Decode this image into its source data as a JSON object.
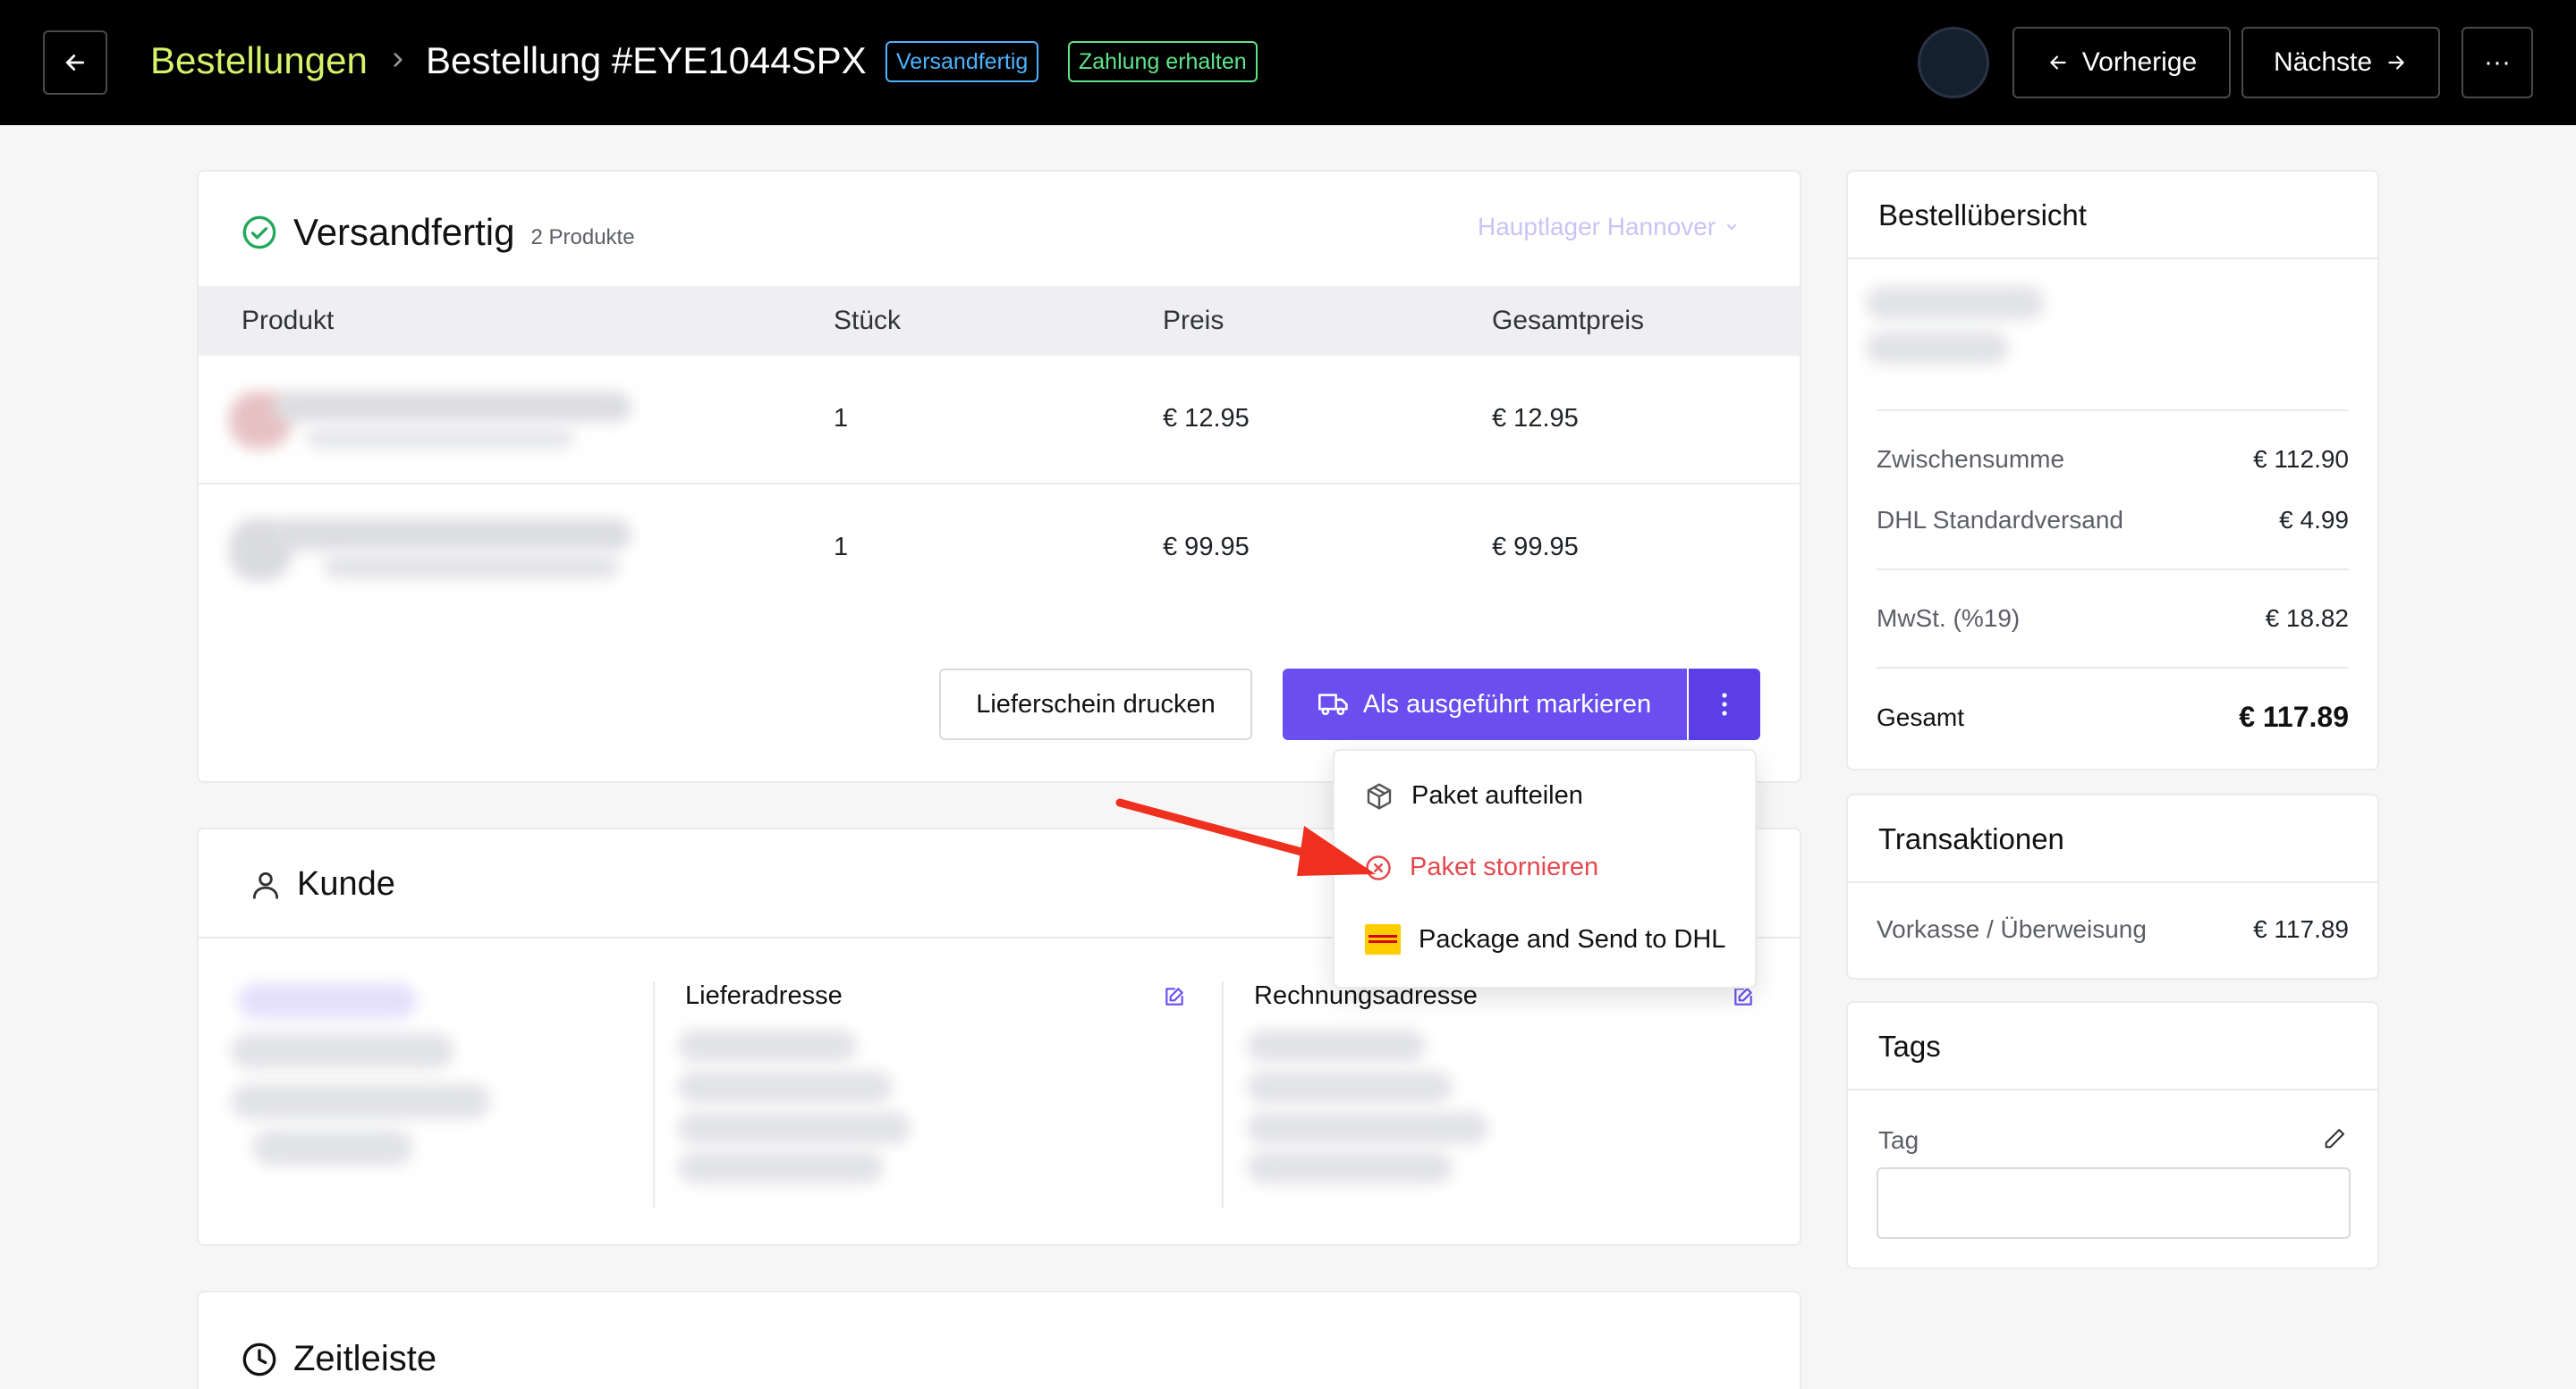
{
  "header": {
    "breadcrumb_root": "Bestellungen",
    "order_title": "Bestellung #EYE1044SPX",
    "badge_status": "Versandfertig",
    "badge_payment": "Zahlung erhalten",
    "prev_label": "Vorherige",
    "next_label": "Nächste",
    "more_label": "···"
  },
  "shipment": {
    "title": "Versandfertig",
    "count": "2 Produkte",
    "warehouse": "Hauptlager Hannover",
    "columns": [
      "Produkt",
      "Stück",
      "Preis",
      "Gesamtpreis"
    ],
    "rows": [
      {
        "qty": "1",
        "price": "€ 12.95",
        "total": "€ 12.95"
      },
      {
        "qty": "1",
        "price": "€ 99.95",
        "total": "€ 99.95"
      }
    ],
    "print_label": "Lieferschein drucken",
    "primary_label": "Als ausgeführt markieren"
  },
  "menu": {
    "items": [
      {
        "label": "Paket aufteilen"
      },
      {
        "label": "Paket stornieren"
      },
      {
        "label": "Package and Send to DHL"
      }
    ]
  },
  "customer": {
    "title": "Kunde",
    "shipping_label": "Lieferadresse",
    "billing_label": "Rechnungsadresse"
  },
  "timeline": {
    "title": "Zeitleiste"
  },
  "summary": {
    "title": "Bestellübersicht",
    "subtotal_label": "Zwischensumme",
    "subtotal_value": "€ 112.90",
    "shipping_label": "DHL Standardversand",
    "shipping_value": "€ 4.99",
    "tax_label": "MwSt. (%19)",
    "tax_value": "€ 18.82",
    "total_label": "Gesamt",
    "total_value": "€ 117.89"
  },
  "transactions": {
    "title": "Transaktionen",
    "method": "Vorkasse / Überweisung",
    "amount": "€ 117.89"
  },
  "tags": {
    "title": "Tags",
    "label": "Tag",
    "input_value": ""
  },
  "colors": {
    "accent": "#6b4ef0",
    "breadcrumb": "#d6f36a",
    "badge_status": "#4cb3ff",
    "badge_payment": "#5ee58b",
    "danger": "#e5484d",
    "annotation_arrow": "#f0301e"
  }
}
